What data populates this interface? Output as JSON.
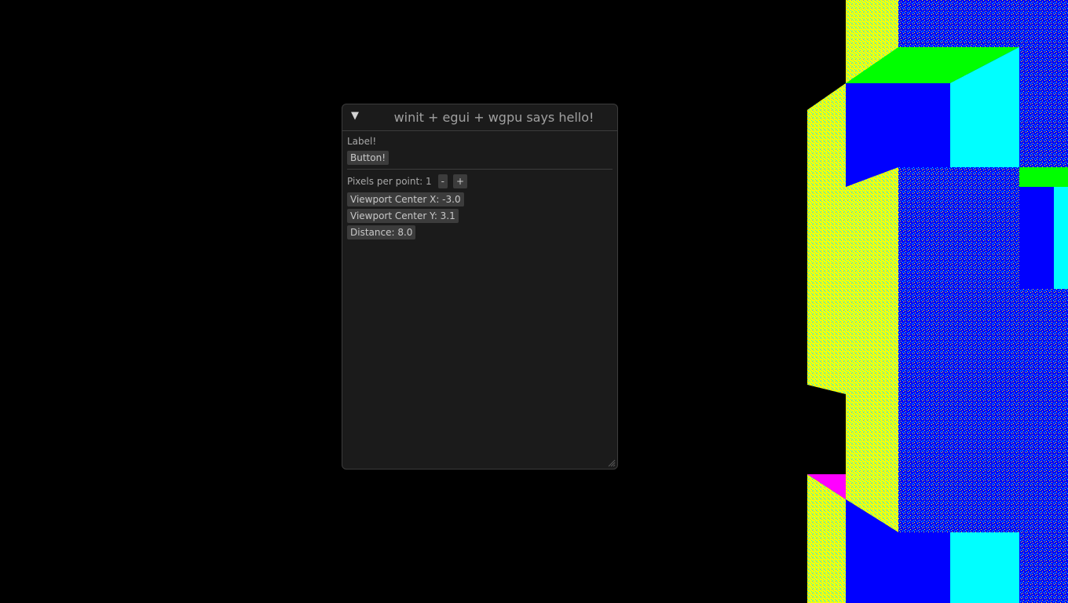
{
  "window": {
    "title": "winit + egui + wgpu says hello!",
    "collapse_icon": "collapse-triangle-icon",
    "collapse_glyph": "▼"
  },
  "content": {
    "label": "Label!",
    "button_label": "Button!",
    "pixels_per_point_label": "Pixels per point: 1",
    "decrease_label": "-",
    "increase_label": "+",
    "viewport_x_label": "Viewport Center X: -3.0",
    "viewport_y_label": "Viewport Center Y: 3.1",
    "distance_label": "Distance: 8.0"
  },
  "scene": {
    "background": "#000000",
    "colors": {
      "yellow": "#ffff00",
      "blue": "#0000ff",
      "cyan": "#00ffff",
      "green": "#00ff00",
      "magenta": "#ff00ff"
    }
  }
}
